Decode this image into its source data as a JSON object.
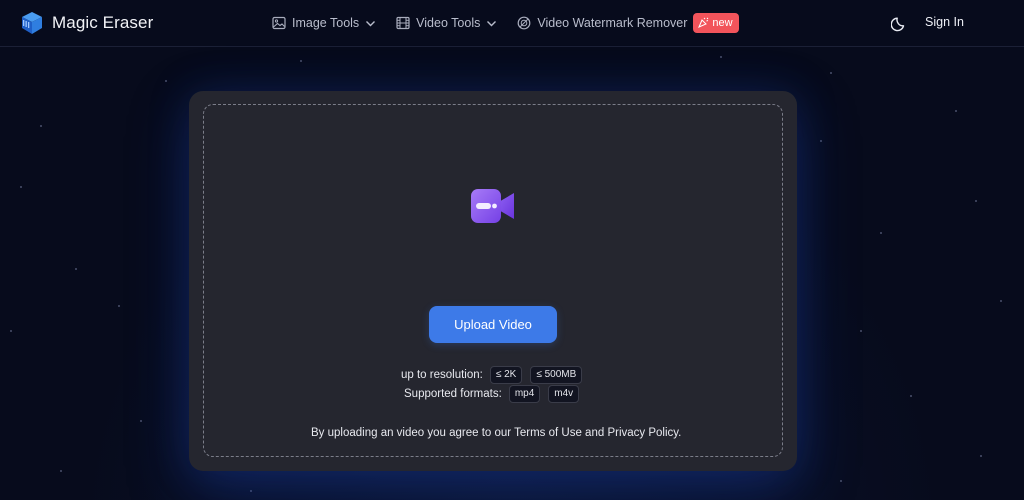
{
  "app": {
    "name": "Magic Eraser"
  },
  "nav": {
    "items": [
      {
        "label": "Image Tools",
        "icon": "image-icon",
        "has_dropdown": true
      },
      {
        "label": "Video Tools",
        "icon": "film-icon",
        "has_dropdown": true
      },
      {
        "label": "Video Watermark Remover",
        "icon": "watermark-icon",
        "has_dropdown": false
      }
    ],
    "new_badge": "new"
  },
  "header_right": {
    "theme_icon": "moon-icon",
    "sign_in": "Sign In"
  },
  "upload": {
    "icon": "video-camera-icon",
    "button_label": "Upload Video",
    "resolution_label": "up to resolution:",
    "resolution_tags": [
      "≤ 2K",
      "≤ 500MB"
    ],
    "formats_label": "Supported formats:",
    "format_tags": [
      "mp4",
      "m4v"
    ],
    "agree_prefix": "By uploading an video you agree to our ",
    "terms_label": "Terms of Use",
    "agree_and": " and ",
    "privacy_label": "Privacy Policy",
    "agree_suffix": "."
  },
  "colors": {
    "background": "#070b1c",
    "card": "#25262f",
    "primary_button": "#3d7ae8",
    "new_badge": "#f2545b",
    "icon_purple": "#8b5cf6"
  }
}
